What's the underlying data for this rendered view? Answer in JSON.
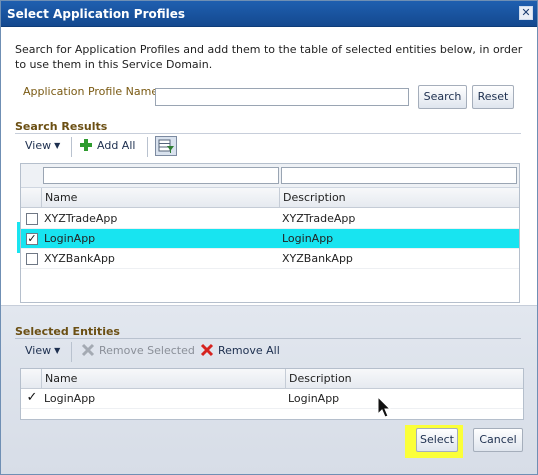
{
  "dialog": {
    "title": "Select Application Profiles",
    "close_glyph": "✕",
    "description": "Search for Application Profiles and add them to the table of selected entities below, in order to use them in this Service Domain."
  },
  "search": {
    "label": "Application Profile Name",
    "value": "",
    "search_label": "Search",
    "reset_label": "Reset"
  },
  "search_results": {
    "title": "Search Results",
    "toolbar": {
      "view_label": "View",
      "add_all_label": "Add All"
    },
    "columns": [
      "Name",
      "Description"
    ],
    "rows": [
      {
        "name": "XYZTradeApp",
        "description": "XYZTradeApp",
        "checked": false
      },
      {
        "name": "LoginApp",
        "description": "LoginApp",
        "checked": true
      },
      {
        "name": "XYZBankApp",
        "description": "XYZBankApp",
        "checked": false
      }
    ]
  },
  "selected_entities": {
    "title": "Selected Entities",
    "toolbar": {
      "view_label": "View",
      "remove_selected_label": "Remove Selected",
      "remove_all_label": "Remove All"
    },
    "columns": [
      "Name",
      "Description"
    ],
    "rows": [
      {
        "name": "LoginApp",
        "description": "LoginApp",
        "checked": true
      }
    ]
  },
  "footer": {
    "select_label": "Select",
    "cancel_label": "Cancel"
  },
  "colors": {
    "title_bar": "#1f5fb0",
    "row_highlight": "#18e4f0",
    "button_highlight": "#fbff38",
    "section_title": "#6b4f13"
  },
  "icons": [
    "close-icon",
    "add-icon",
    "grid-filter-icon",
    "remove-selected-icon",
    "remove-all-icon",
    "mouse-pointer-icon"
  ]
}
